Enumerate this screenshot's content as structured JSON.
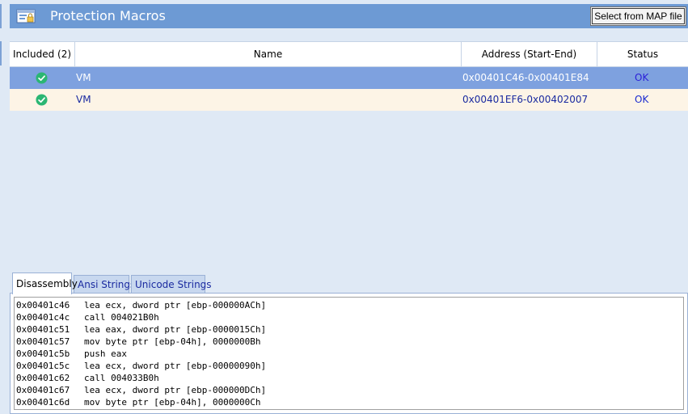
{
  "header": {
    "title": "Protection Macros",
    "select_map_label": "Select from MAP file"
  },
  "table": {
    "columns": [
      "Included (2)",
      "Name",
      "Address (Start-End)",
      "Status"
    ],
    "rows": [
      {
        "included": true,
        "name": "VM",
        "address": "0x00401C46-0x00401E84",
        "status": "OK",
        "selected": true
      },
      {
        "included": true,
        "name": "VM",
        "address": "0x00401EF6-0x00402007",
        "status": "OK",
        "selected": false
      }
    ]
  },
  "tabs": [
    "Disassembly",
    "Ansi Strings",
    "Unicode Strings"
  ],
  "active_tab": "Disassembly",
  "disassembly": [
    {
      "addr": "0x00401c46",
      "instr": "lea ecx, dword ptr [ebp-000000ACh]"
    },
    {
      "addr": "0x00401c4c",
      "instr": "call 004021B0h"
    },
    {
      "addr": "0x00401c51",
      "instr": "lea eax, dword ptr [ebp-0000015Ch]"
    },
    {
      "addr": "0x00401c57",
      "instr": "mov byte ptr [ebp-04h], 0000000Bh"
    },
    {
      "addr": "0x00401c5b",
      "instr": "push eax"
    },
    {
      "addr": "0x00401c5c",
      "instr": "lea ecx, dword ptr [ebp-00000090h]"
    },
    {
      "addr": "0x00401c62",
      "instr": "call 004033B0h"
    },
    {
      "addr": "0x00401c67",
      "instr": "lea ecx, dword ptr [ebp-000000DCh]"
    },
    {
      "addr": "0x00401c6d",
      "instr": "mov byte ptr [ebp-04h], 0000000Ch"
    }
  ],
  "colors": {
    "header_bg": "#6d9ad4",
    "selected_row": "#7ea1df",
    "alt_row": "#fdf4e6",
    "check_green": "#2bb673"
  },
  "icons": {
    "header": "protection-macros-icon",
    "included": "check-circle-icon"
  }
}
